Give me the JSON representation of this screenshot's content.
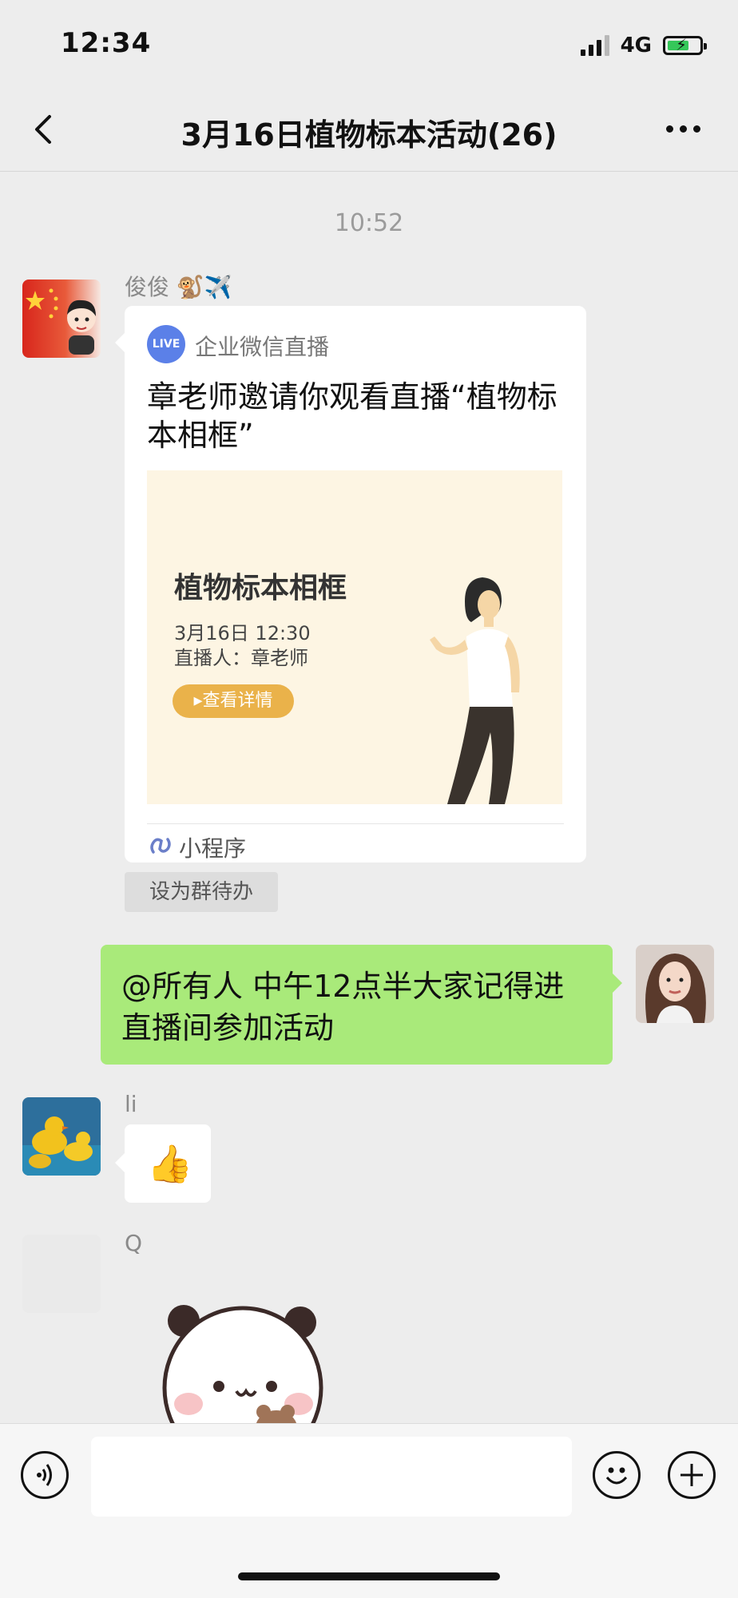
{
  "status": {
    "time": "12:34",
    "network": "4G"
  },
  "nav": {
    "title": "3月16日植物标本活动(26)"
  },
  "timestamp": "10:52",
  "messages": {
    "first": {
      "sender": "俊俊 🐒✈️",
      "card": {
        "logo_text": "LIVE",
        "source": "企业微信直播",
        "title": "章老师邀请你观看直播“植物标本相框”",
        "image": {
          "title": "植物标本相框",
          "date": "3月16日 12:30",
          "host": "直播人：章老师",
          "button": "▸查看详情"
        },
        "footer": "小程序"
      },
      "todo_label": "设为群待办"
    },
    "mine": {
      "text": "@所有人 中午12点半大家记得进直播间参加活动"
    },
    "li": {
      "sender": "li",
      "emoji": "👍"
    },
    "q": {
      "sender": "Q"
    }
  },
  "colors": {
    "background": "#ededed",
    "my_bubble": "#a9ea7a",
    "live_logo": "#5b80e8",
    "card_image_bg": "#fdf5e3",
    "detail_button": "#eab24a",
    "battery": "#35c759"
  },
  "icons": {
    "back": "chevron-left-icon",
    "more": "more-dots-icon",
    "voice": "voice-icon",
    "emoji": "emoji-icon",
    "plus": "plus-icon",
    "mini_program": "mini-program-icon"
  }
}
